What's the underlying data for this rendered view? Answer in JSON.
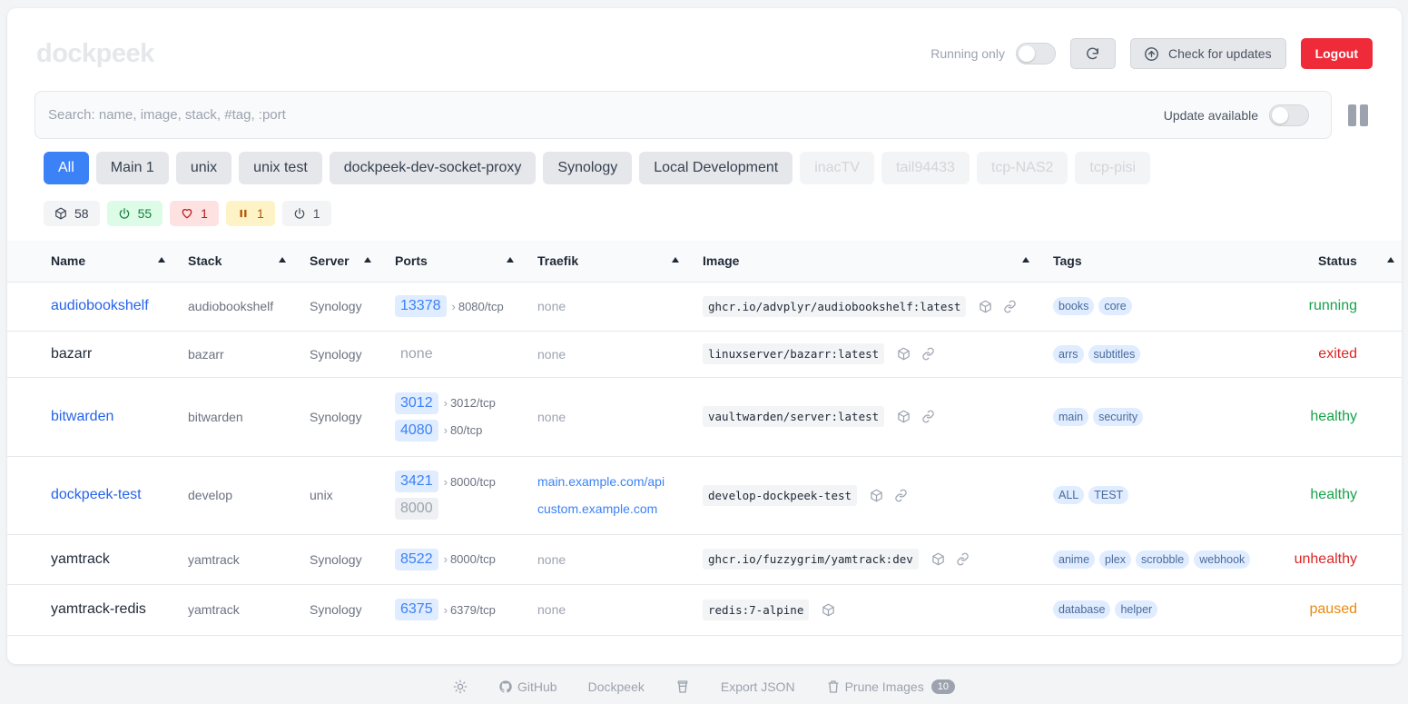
{
  "app": {
    "title": "dockpeek"
  },
  "topbar": {
    "running_only_label": "Running only",
    "check_updates_label": "Check for updates",
    "logout_label": "Logout"
  },
  "search": {
    "placeholder": "Search: name, image, stack, #tag, :port",
    "update_available_label": "Update available"
  },
  "filters": [
    {
      "label": "All",
      "state": "active"
    },
    {
      "label": "Main 1",
      "state": "normal"
    },
    {
      "label": "unix",
      "state": "normal"
    },
    {
      "label": "unix test",
      "state": "normal"
    },
    {
      "label": "dockpeek-dev-socket-proxy",
      "state": "normal"
    },
    {
      "label": "Synology",
      "state": "normal"
    },
    {
      "label": "Local Development",
      "state": "normal"
    },
    {
      "label": "inacTV",
      "state": "inactive"
    },
    {
      "label": "tail94433",
      "state": "inactive"
    },
    {
      "label": "tcp-NAS2",
      "state": "inactive"
    },
    {
      "label": "tcp-pisi",
      "state": "inactive"
    }
  ],
  "counters": {
    "total": "58",
    "running": "55",
    "unhealthy": "1",
    "paused": "1",
    "exited": "1"
  },
  "table": {
    "headers": {
      "name": "Name",
      "stack": "Stack",
      "server": "Server",
      "ports": "Ports",
      "traefik": "Traefik",
      "image": "Image",
      "tags": "Tags",
      "status": "Status"
    },
    "rows": [
      {
        "name": "audiobookshelf",
        "link": true,
        "stack": "audiobookshelf",
        "server": "Synology",
        "ports": [
          {
            "host": "13378",
            "container": "8080/tcp"
          }
        ],
        "traefik": "none",
        "traefik_links": [],
        "image": "ghcr.io/advplyr/audiobookshelf:latest",
        "has_link": true,
        "tags": [
          "books",
          "core"
        ],
        "status": "running",
        "status_class": "s-running"
      },
      {
        "name": "bazarr",
        "link": false,
        "stack": "bazarr",
        "server": "Synology",
        "ports": [],
        "ports_none": "none",
        "traefik": "none",
        "traefik_links": [],
        "image": "linuxserver/bazarr:latest",
        "has_link": true,
        "tags": [
          "arrs",
          "subtitles"
        ],
        "status": "exited",
        "status_class": "s-exited"
      },
      {
        "name": "bitwarden",
        "link": true,
        "stack": "bitwarden",
        "server": "Synology",
        "ports": [
          {
            "host": "3012",
            "container": "3012/tcp"
          },
          {
            "host": "4080",
            "container": "80/tcp"
          }
        ],
        "traefik": "none",
        "traefik_links": [],
        "image": "vaultwarden/server:latest",
        "has_link": true,
        "tags": [
          "main",
          "security"
        ],
        "status": "healthy",
        "status_class": "s-healthy"
      },
      {
        "name": "dockpeek-test",
        "link": true,
        "stack": "develop",
        "server": "unix",
        "ports": [
          {
            "host": "3421",
            "container": "8000/tcp"
          },
          {
            "host": "8000",
            "container": "",
            "gray": true
          }
        ],
        "traefik": "",
        "traefik_links": [
          "main.example.com/api",
          "custom.example.com"
        ],
        "image": "develop-dockpeek-test",
        "has_link": true,
        "tags": [
          "ALL",
          "TEST"
        ],
        "status": "healthy",
        "status_class": "s-healthy"
      },
      {
        "name": "yamtrack",
        "link": false,
        "stack": "yamtrack",
        "server": "Synology",
        "ports": [
          {
            "host": "8522",
            "container": "8000/tcp"
          }
        ],
        "traefik": "none",
        "traefik_links": [],
        "image": "ghcr.io/fuzzygrim/yamtrack:dev",
        "has_link": true,
        "tags": [
          "anime",
          "plex",
          "scrobble",
          "webhook"
        ],
        "status": "unhealthy",
        "status_class": "s-unhealthy"
      },
      {
        "name": "yamtrack-redis",
        "link": false,
        "stack": "yamtrack",
        "server": "Synology",
        "ports": [
          {
            "host": "6375",
            "container": "6379/tcp"
          }
        ],
        "traefik": "none",
        "traefik_links": [],
        "image": "redis:7-alpine",
        "has_link": false,
        "tags": [
          "database",
          "helper"
        ],
        "status": "paused",
        "status_class": "s-paused"
      }
    ]
  },
  "footer": {
    "github_label": "GitHub",
    "dockpeek_label": "Dockpeek",
    "export_label": "Export JSON",
    "prune_label": "Prune Images",
    "prune_count": "10"
  },
  "colors": {
    "accent": "#3b82f6",
    "logout": "#ef2b3a",
    "healthy": "#16a34a",
    "error": "#dc2626",
    "paused": "#ea8a0c"
  }
}
